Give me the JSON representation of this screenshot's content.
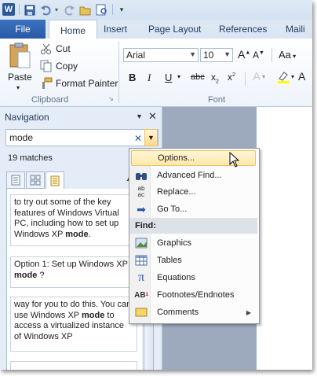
{
  "ribbon_tabs": {
    "file": "File",
    "home": "Home",
    "insert": "Insert",
    "page_layout": "Page Layout",
    "references": "References",
    "mailings": "Maili"
  },
  "clipboard": {
    "paste": "Paste",
    "cut": "Cut",
    "copy": "Copy",
    "format_painter": "Format Painter",
    "label": "Clipboard"
  },
  "font": {
    "name": "Arial",
    "size": "10",
    "label": "Font",
    "case_btn": "Aa"
  },
  "navigation": {
    "title": "Navigation",
    "search_value": "mode",
    "matches": "19 matches",
    "results": [
      {
        "before": "to try out some of the key features of Windows Virtual PC, including how to set up Windows XP ",
        "bold": "mode",
        "after": "."
      },
      {
        "before": "Option 1: Set up Windows XP ",
        "bold": "mode",
        "after": " ?"
      },
      {
        "before": "way for you to do this. You can use Windows XP ",
        "bold": "mode",
        "after": " to access a virtualized instance of Windows XP"
      }
    ]
  },
  "menu": {
    "items_top": [
      {
        "icon": "blank-icon",
        "label": "Options..."
      },
      {
        "icon": "binoculars-icon",
        "label": "Advanced Find..."
      },
      {
        "icon": "replace-icon",
        "label": "Replace..."
      },
      {
        "icon": "goto-arrow-icon",
        "label": "Go To..."
      }
    ],
    "find_header": "Find:",
    "items_find": [
      {
        "icon": "graphics-icon",
        "label": "Graphics"
      },
      {
        "icon": "table-icon",
        "label": "Tables"
      },
      {
        "icon": "pi-icon",
        "label": "Equations"
      },
      {
        "icon": "footnote-icon",
        "label": "Footnotes/Endnotes"
      },
      {
        "icon": "comment-icon",
        "label": "Comments"
      }
    ]
  },
  "colors": {
    "file_tab": "#2a5aa6",
    "menu_highlight": "#ffe8a8",
    "nav_bg": "#e4ecf7"
  }
}
